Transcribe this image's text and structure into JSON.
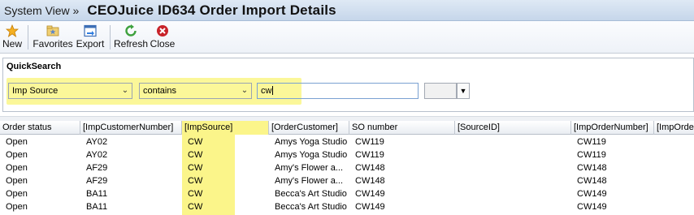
{
  "titlebar": {
    "breadcrumb": "System View »",
    "title": "CEOJuice ID634 Order Import Details"
  },
  "toolbar": {
    "new_label": "New",
    "favorites_label": "Favorites",
    "export_label": "Export",
    "refresh_label": "Refresh",
    "close_label": "Close"
  },
  "quicksearch": {
    "title": "QuickSearch",
    "field_value": "Imp Source",
    "operator_value": "contains",
    "search_value": "cw"
  },
  "colors": {
    "highlight": "#fbf799",
    "title_bar": "#c6d6ea"
  },
  "table": {
    "headers": [
      "Order status",
      "[ImpCustomerNumber]",
      "[ImpSource]",
      "[OrderCustomer]",
      "SO number",
      "[SourceID]",
      "[ImpOrderNumber]",
      "[ImpOrde"
    ],
    "rows": [
      [
        "Open",
        "AY02",
        "CW",
        "Amys Yoga Studio",
        "CW119",
        "",
        "CW119"
      ],
      [
        "Open",
        "AY02",
        "CW",
        "Amys Yoga Studio",
        "CW119",
        "",
        "CW119"
      ],
      [
        "Open",
        "AF29",
        "CW",
        "Amy's Flower a...",
        "CW148",
        "",
        "CW148"
      ],
      [
        "Open",
        "AF29",
        "CW",
        "Amy's Flower a...",
        "CW148",
        "",
        "CW148"
      ],
      [
        "Open",
        "BA11",
        "CW",
        "Becca's Art Studio",
        "CW149",
        "",
        "CW149"
      ],
      [
        "Open",
        "BA11",
        "CW",
        "Becca's Art Studio",
        "CW149",
        "",
        "CW149"
      ]
    ]
  }
}
